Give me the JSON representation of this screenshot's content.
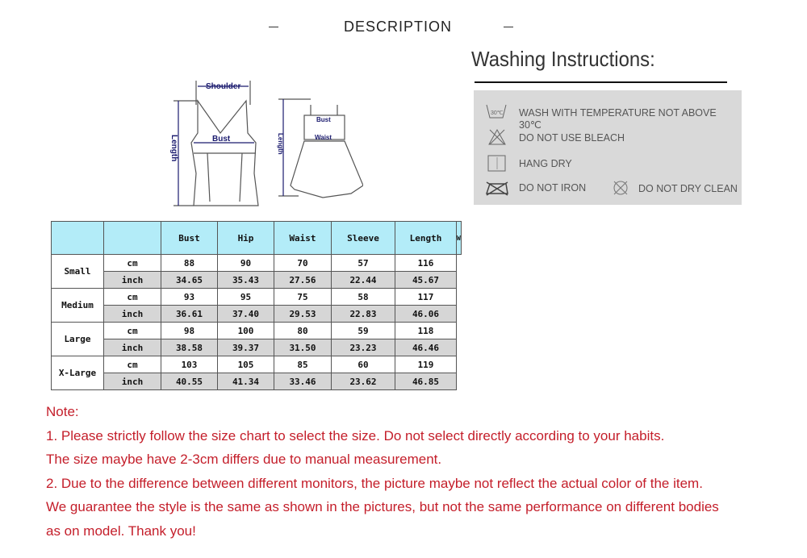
{
  "header": {
    "title": "DESCRIPTION"
  },
  "diagram": {
    "labels": {
      "shoulder": "Shoulder",
      "bust": "Bust",
      "length": "Length",
      "waist": "Waist"
    }
  },
  "washing": {
    "title": "Washing Instructions:",
    "items": [
      {
        "icon": "wash-30-icon",
        "icon_text": "30℃",
        "label": "WASH WITH TEMPERATURE NOT ABOVE 30℃"
      },
      {
        "icon": "no-bleach-icon",
        "label": "DO NOT USE BLEACH"
      },
      {
        "icon": "hang-dry-icon",
        "label": "HANG DRY"
      },
      {
        "icon": "no-iron-icon",
        "label": "DO NOT IRON"
      },
      {
        "icon": "no-dry-clean-icon",
        "label": "DO NOT DRY CLEAN"
      }
    ]
  },
  "size_table": {
    "headers": [
      "",
      "",
      "Bust",
      "Hip",
      "Waist",
      "Sleeve",
      "Length",
      "W"
    ],
    "rows": [
      {
        "size": "Small",
        "cm": [
          "cm",
          "88",
          "90",
          "70",
          "57",
          "116"
        ],
        "inch": [
          "inch",
          "34.65",
          "35.43",
          "27.56",
          "22.44",
          "45.67"
        ]
      },
      {
        "size": "Medium",
        "cm": [
          "cm",
          "93",
          "95",
          "75",
          "58",
          "117"
        ],
        "inch": [
          "inch",
          "36.61",
          "37.40",
          "29.53",
          "22.83",
          "46.06"
        ]
      },
      {
        "size": "Large",
        "cm": [
          "cm",
          "98",
          "100",
          "80",
          "59",
          "118"
        ],
        "inch": [
          "inch",
          "38.58",
          "39.37",
          "31.50",
          "23.23",
          "46.46"
        ]
      },
      {
        "size": "X-Large",
        "cm": [
          "cm",
          "103",
          "105",
          "85",
          "60",
          "119"
        ],
        "inch": [
          "inch",
          "40.55",
          "41.34",
          "33.46",
          "23.62",
          "46.85"
        ]
      }
    ]
  },
  "notes": [
    "Note:",
    "1. Please strictly follow the size chart to select the size. Do not select directly according to your habits.",
    "The size maybe have 2-3cm differs due to manual measurement.",
    "2. Due to the difference between different monitors, the picture maybe not reflect the actual color of the item.",
    "We guarantee the style is the same as shown in the pictures, but not the same performance on different bodies",
    "as on model. Thank you!"
  ],
  "colors": {
    "note_text": "#c41e2a",
    "table_header": "#b3ecf8",
    "inch_row": "#d6d6d6",
    "wash_box": "#d9d9d9"
  }
}
